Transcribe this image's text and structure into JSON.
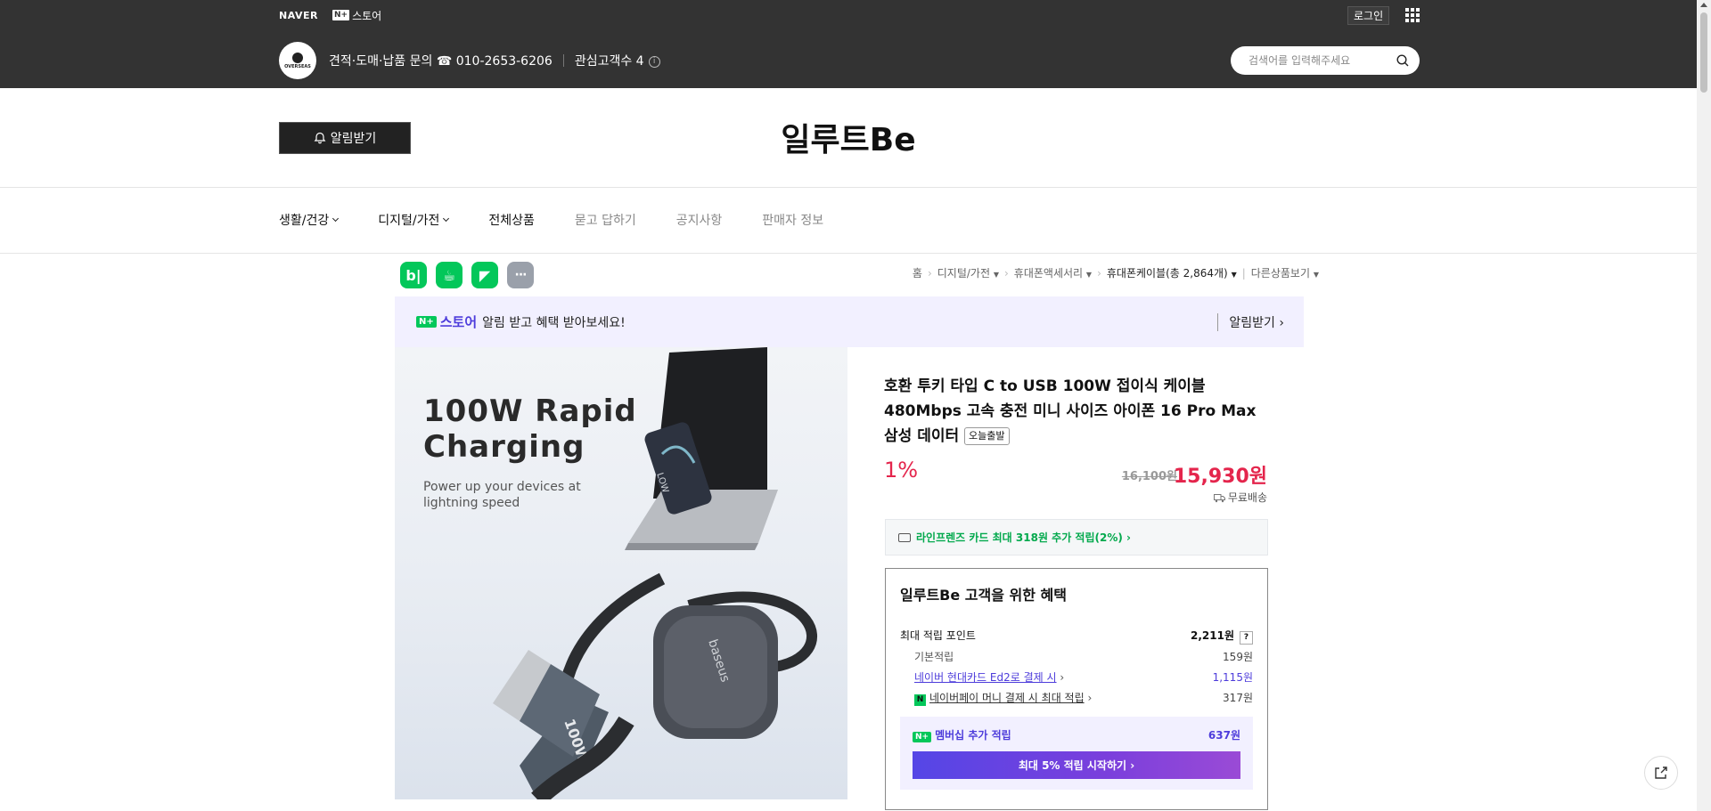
{
  "header": {
    "naver_logo": "NAVER",
    "nplus": "N+",
    "store_label": "스토어",
    "login": "로그인",
    "avatar_text": "OVERSEAS",
    "contact": "견적·도매·납품 문의 ☎ 010-2653-6206",
    "interest": "관심고객수 4",
    "search_placeholder": "검색어를 입력해주세요"
  },
  "store": {
    "alarm_button": "알림받기",
    "title": "일루트Be"
  },
  "nav": {
    "items": [
      "생활/건강",
      "디지털/가전",
      "전체상품",
      "묻고 답하기",
      "공지사항",
      "판매자 정보"
    ]
  },
  "share": {
    "blog": "b|",
    "cafe": "☕",
    "bookmark": "◤",
    "more": "···"
  },
  "breadcrumb": {
    "home": "홈",
    "c1": "디지털/가전",
    "c2": "휴대폰액세서리",
    "c3": "휴대폰케이블(총 2,864개)",
    "c4": "다른상품보기"
  },
  "banner": {
    "nplus": "N+",
    "store": "스토어",
    "message": "알림 받고 혜택 받아보세요!",
    "right": "알림받기 ›"
  },
  "image": {
    "title_line1": "100W Rapid",
    "title_line2": "Charging",
    "sub_line1": "Power up your devices at",
    "sub_line2": "lightning speed",
    "brand": "baseus",
    "cable_label": "100W",
    "phone_label": "LOW"
  },
  "product": {
    "title": "호환 투키 타입 C to USB 100W 접이식 케이블 480Mbps 고속 충전 미니 사이즈 아이폰 16 Pro Max 삼성 데이터",
    "badge": "오늘출발",
    "discount": "1%",
    "original_price": "16,100원",
    "sale_price": "15,930원",
    "shipping": "무료배송",
    "card_benefit": "라인프렌즈 카드 최대 318원 추가 적립(2%) ›"
  },
  "benefit": {
    "title": "일루트Be 고객을 위한 혜택",
    "max_points_label": "최대 적립 포인트",
    "max_points": "2,211원",
    "q": "?",
    "basic_label": "기본적립",
    "basic": "159원",
    "hyundai_label": "네이버 현대카드 Ed2로 결제 시",
    "hyundai": "1,115원",
    "npay_label": "네이버페이 머니 결제 시 최대 적립",
    "npay_icon": "N",
    "npay": "317원",
    "membership_label": "멤버십 추가 적립",
    "membership": "637원",
    "start_button": "최대 5% 적립 시작하기 ›"
  },
  "colors": {
    "header_bg": "#333333",
    "naver_green": "#03c75a",
    "purple": "#4d3cdb",
    "price_red": "#e4254c"
  }
}
